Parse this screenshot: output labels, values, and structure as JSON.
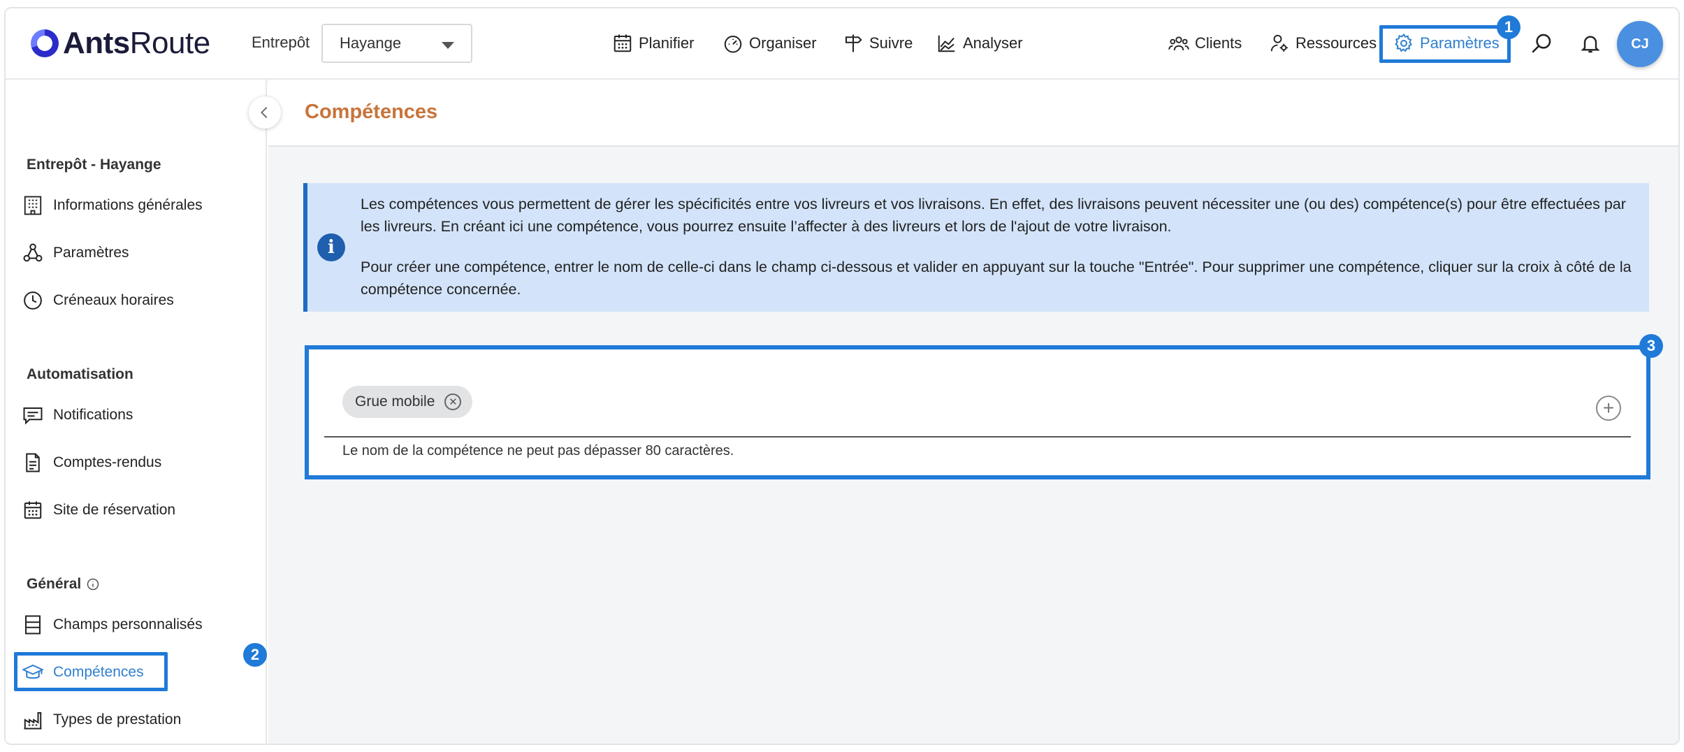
{
  "app": {
    "logo_bold": "Ants",
    "logo_light": "Route"
  },
  "header": {
    "warehouse_label": "Entrepôt",
    "warehouse_value": "Hayange",
    "nav": [
      {
        "label": "Planifier",
        "icon": "calendar-icon"
      },
      {
        "label": "Organiser",
        "icon": "gauge-icon"
      },
      {
        "label": "Suivre",
        "icon": "signpost-icon"
      },
      {
        "label": "Analyser",
        "icon": "chart-icon"
      }
    ],
    "right_nav": [
      {
        "label": "Clients",
        "icon": "users-icon"
      },
      {
        "label": "Ressources",
        "icon": "user-gear-icon"
      },
      {
        "label": "Paramètres",
        "icon": "gear-icon",
        "active": true
      }
    ],
    "avatar_initials": "CJ",
    "accent_color": "#1f7ad8"
  },
  "annotations": {
    "badge_1": "1",
    "badge_2": "2",
    "badge_3": "3"
  },
  "sidebar": {
    "sections": [
      {
        "title": "Entrepôt - Hayange",
        "items": [
          "Informations générales",
          "Paramètres",
          "Créneaux horaires"
        ]
      },
      {
        "title": "Automatisation",
        "items": [
          "Notifications",
          "Comptes-rendus",
          "Site de réservation"
        ]
      },
      {
        "title": "Général",
        "items": [
          "Champs personnalisés",
          "Compétences",
          "Types de prestation"
        ]
      }
    ],
    "active_item": "Compétences"
  },
  "main": {
    "title": "Compétences",
    "info_p1": "Les compétences vous permettent de gérer les spécificités entre vos livreurs et vos livraisons. En effet, des livraisons peuvent nécessiter une (ou des) compétence(s) pour être effectuées par les livreurs. En créant ici une compétence, vous pourrez ensuite l’affecter à des livreurs et lors de l'ajout de votre livraison.",
    "info_p2": "Pour créer une compétence, entrer le nom de celle-ci dans le champ ci-dessous et valider en appuyant sur la touche \"Entrée\". Pour supprimer une compétence, cliquer sur la croix à côté de la compétence concernée.",
    "chips": [
      "Grue mobile"
    ],
    "help_text": "Le nom de la compétence ne peut pas dépasser 80 caractères."
  }
}
